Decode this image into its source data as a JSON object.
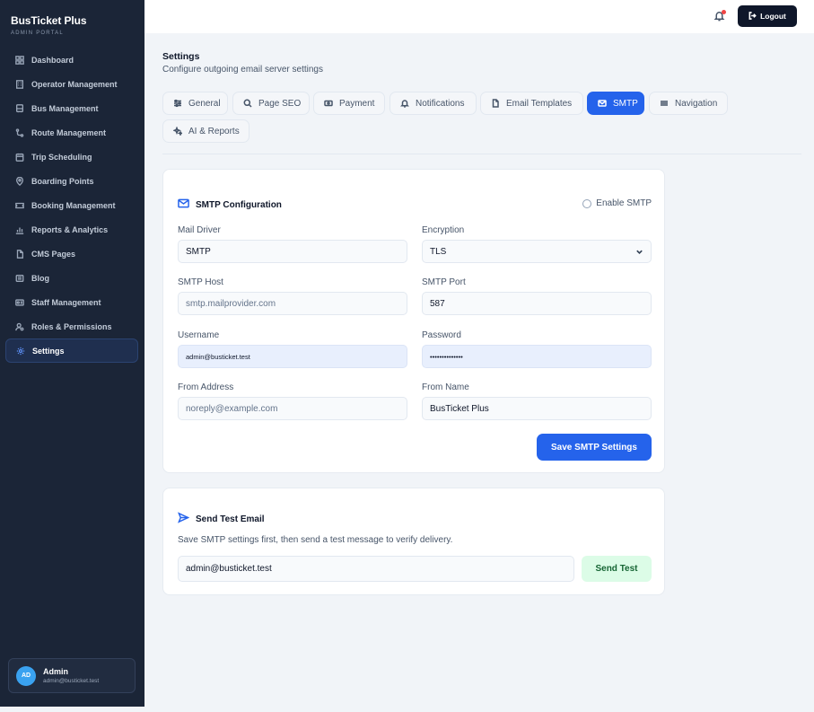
{
  "app": {
    "title": "BusTicket Plus",
    "subtitle": "ADMIN PORTAL"
  },
  "sidebar": {
    "items": [
      {
        "label": "Dashboard",
        "icon": "dashboard-icon",
        "active": false
      },
      {
        "label": "Operator Management",
        "icon": "building-icon",
        "active": false
      },
      {
        "label": "Bus Management",
        "icon": "bus-icon",
        "active": false
      },
      {
        "label": "Route Management",
        "icon": "route-icon",
        "active": false
      },
      {
        "label": "Trip Scheduling",
        "icon": "calendar-icon",
        "active": false
      },
      {
        "label": "Boarding Points",
        "icon": "map-pin-icon",
        "active": false
      },
      {
        "label": "Booking Management",
        "icon": "ticket-icon",
        "active": false
      },
      {
        "label": "Reports & Analytics",
        "icon": "chart-icon",
        "active": false
      },
      {
        "label": "CMS Pages",
        "icon": "file-icon",
        "active": false
      },
      {
        "label": "Blog",
        "icon": "newspaper-icon",
        "active": false
      },
      {
        "label": "Staff Management",
        "icon": "id-card-icon",
        "active": false
      },
      {
        "label": "Roles & Permissions",
        "icon": "user-cog-icon",
        "active": false
      },
      {
        "label": "Settings",
        "icon": "gear-icon",
        "active": true
      }
    ]
  },
  "user": {
    "initials": "AD",
    "name": "Admin",
    "email": "admin@busticket.test"
  },
  "topbar": {
    "logout_label": "Logout",
    "notification_icon": "bell-icon",
    "accent_color": "#0f172a"
  },
  "page": {
    "title": "Settings",
    "subtitle": "Configure outgoing email server settings"
  },
  "tabs": [
    {
      "label": "General",
      "icon": "sliders-icon",
      "active": false
    },
    {
      "label": "Page SEO",
      "icon": "seo-search-icon",
      "active": false
    },
    {
      "label": "Payment",
      "icon": "payment-icon",
      "active": false
    },
    {
      "label": "Notifications",
      "icon": "bell-icon",
      "active": false
    },
    {
      "label": "Email Templates",
      "icon": "file-icon",
      "active": false
    },
    {
      "label": "SMTP",
      "icon": "mail-icon",
      "active": true
    },
    {
      "label": "Navigation",
      "icon": "menu-icon",
      "active": false
    },
    {
      "label": "AI & Reports",
      "icon": "sparkles-icon",
      "active": false
    }
  ],
  "smtp": {
    "title": "SMTP Configuration",
    "enable_label": "Enable SMTP",
    "enabled": false,
    "fields": {
      "mail_driver": {
        "label": "Mail Driver",
        "value": "SMTP"
      },
      "encryption": {
        "label": "Encryption",
        "value": "TLS"
      },
      "host": {
        "label": "SMTP Host",
        "placeholder": "smtp.mailprovider.com"
      },
      "port": {
        "label": "SMTP Port",
        "value": "587"
      },
      "username": {
        "label": "Username",
        "value": "admin@busticket.test"
      },
      "password": {
        "label": "Password",
        "value": "••••••••••••••"
      },
      "from_address": {
        "label": "From Address",
        "placeholder": "noreply@example.com"
      },
      "from_name": {
        "label": "From Name",
        "value": "BusTicket Plus"
      }
    },
    "save_label": "Save SMTP Settings"
  },
  "test_email": {
    "title": "Send Test Email",
    "hint": "Save SMTP settings first, then send a test message to verify delivery.",
    "recipient": "admin@busticket.test",
    "send_label": "Send Test"
  },
  "colors": {
    "primary": "#2563eb",
    "sidebar_bg": "#1b2537",
    "success_bg": "#dcfce7",
    "success_text": "#166534"
  }
}
